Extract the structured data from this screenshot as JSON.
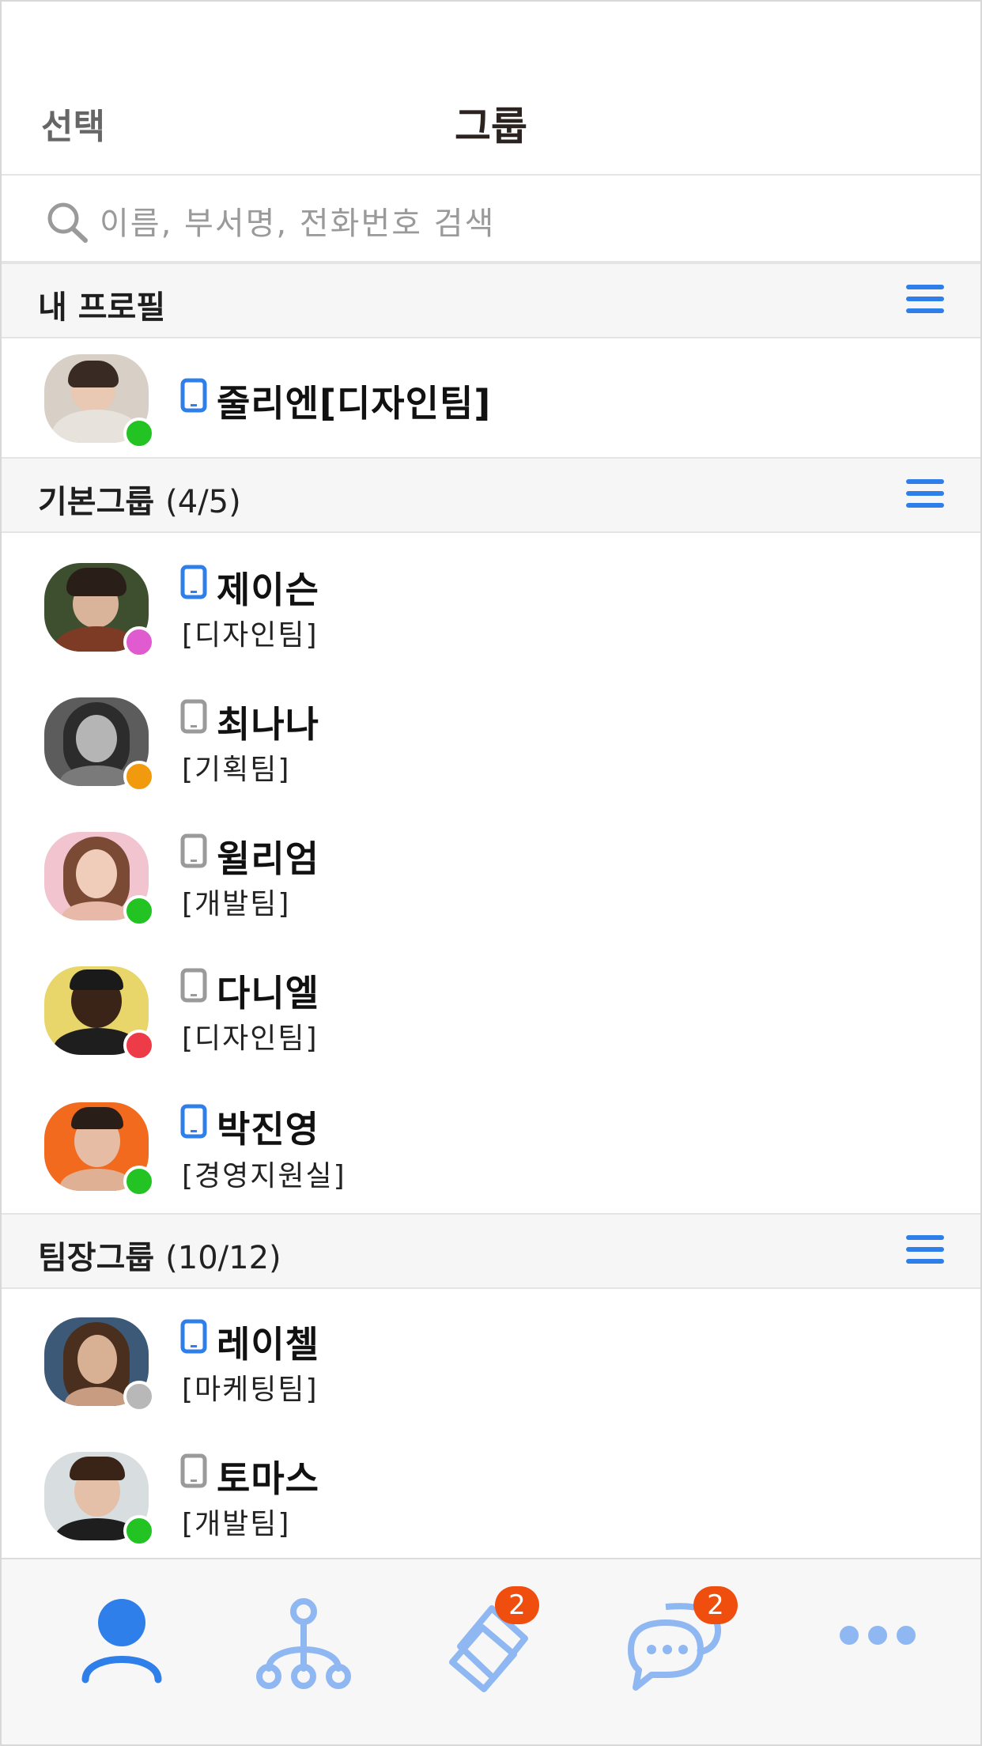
{
  "header": {
    "select_label": "선택",
    "title": "그룹"
  },
  "search": {
    "placeholder": "이름, 부서명, 전화번호 검색"
  },
  "my_profile": {
    "section_label": "내 프로필",
    "user": {
      "name": "줄리엔[디자인팀]",
      "status_color": "#22c322",
      "phone_color": "#2f7fea"
    }
  },
  "basic_group": {
    "section_label": "기본그룹",
    "count": "(4/5)",
    "members": [
      {
        "name": "제이슨",
        "dept": "[디자인팀]",
        "status_color": "#e05ad0",
        "phone_color": "#2f7fea"
      },
      {
        "name": "최나나",
        "dept": "[기획팀]",
        "status_color": "#f29a0e",
        "phone_color": "#9a9a9a"
      },
      {
        "name": "윌리엄",
        "dept": "[개발팀]",
        "status_color": "#22c322",
        "phone_color": "#9a9a9a"
      },
      {
        "name": "다니엘",
        "dept": "[디자인팀]",
        "status_color": "#ee3b48",
        "phone_color": "#9a9a9a"
      },
      {
        "name": "박진영",
        "dept": "[경영지원실]",
        "status_color": "#22c322",
        "phone_color": "#2f7fea"
      }
    ]
  },
  "leader_group": {
    "section_label": "팀장그룹",
    "count": "(10/12)",
    "members": [
      {
        "name": "레이첼",
        "dept": "[마케팅팀]",
        "status_color": "#b8b8b8",
        "phone_color": "#2f7fea"
      },
      {
        "name": "토마스",
        "dept": "[개발팀]",
        "status_color": "#22c322",
        "phone_color": "#9a9a9a"
      }
    ]
  },
  "tabbar": {
    "tabs": [
      {
        "icon": "person-icon",
        "active": true
      },
      {
        "icon": "org-chart-icon",
        "active": false
      },
      {
        "icon": "notes-icon",
        "badge": "2"
      },
      {
        "icon": "chat-icon",
        "badge": "2"
      },
      {
        "icon": "more-icon",
        "active": false
      }
    ],
    "accent_color": "#2f7fea",
    "inactive_color": "#8fb8f2"
  }
}
